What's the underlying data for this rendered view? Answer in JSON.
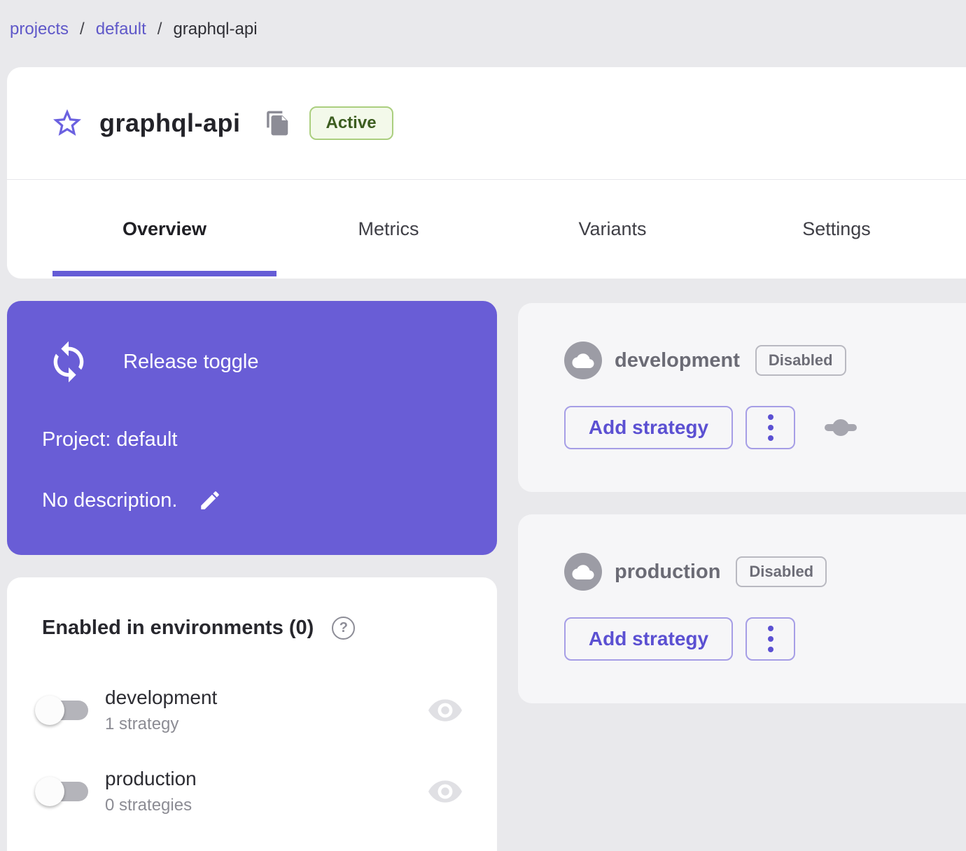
{
  "colors": {
    "page_background": "#e9e9ec",
    "accent_purple": "#635bd4",
    "card_purple": "#695dd6",
    "tab_underline": "#655cd6",
    "active_badge_bg": "#f3f9ea",
    "active_badge_border": "#abcf7f",
    "active_badge_text": "#3c5d20",
    "muted_gray_text": "#6b6b75",
    "env_card_bg": "#f6f6f8"
  },
  "breadcrumb": {
    "separator": "/",
    "items": [
      {
        "label": "projects"
      },
      {
        "label": "default"
      },
      {
        "label": "graphql-api"
      }
    ]
  },
  "header": {
    "title": "graphql-api",
    "status_badge": "Active"
  },
  "tabs": [
    {
      "label": "Overview",
      "active": true
    },
    {
      "label": "Metrics",
      "active": false
    },
    {
      "label": "Variants",
      "active": false
    },
    {
      "label": "Settings",
      "active": false
    }
  ],
  "toggle_card": {
    "type_label": "Release toggle",
    "project_label": "Project: default",
    "description_label": "No description."
  },
  "environments": [
    {
      "name": "development",
      "status": "Disabled",
      "add_strategy_label": "Add strategy",
      "has_slider_icon": true
    },
    {
      "name": "production",
      "status": "Disabled",
      "add_strategy_label": "Add strategy",
      "has_slider_icon": false
    }
  ],
  "enabled_panel": {
    "title": "Enabled in environments (0)",
    "help_glyph": "?",
    "rows": [
      {
        "name": "development",
        "strategies": "1 strategy",
        "enabled": false
      },
      {
        "name": "production",
        "strategies": "0 strategies",
        "enabled": false
      }
    ]
  },
  "icons": {
    "favorite": "star-outline-icon",
    "copy": "copy-icon",
    "toggle_type": "loop-arrows-icon",
    "edit": "pencil-icon",
    "environment": "cloud-icon",
    "more_actions": "kebab-menu-icon",
    "strategy_handle": "slider-icon",
    "help": "question-mark-circle-icon",
    "visibility": "eye-icon"
  }
}
